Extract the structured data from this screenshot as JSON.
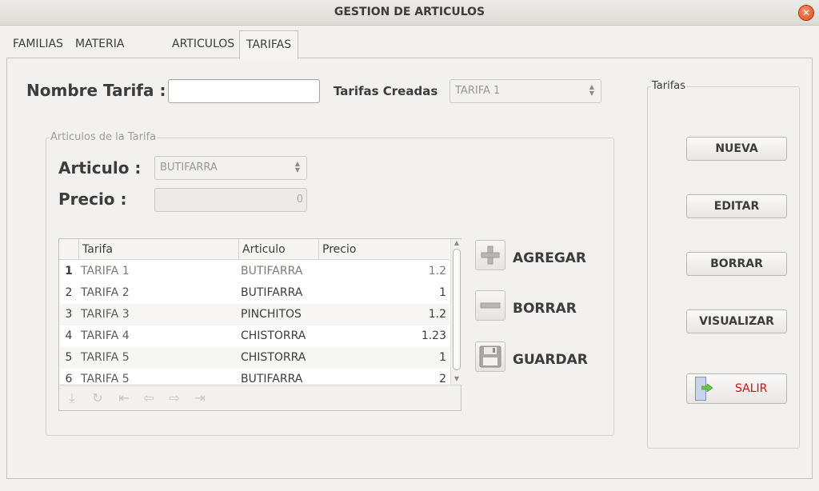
{
  "window": {
    "title": "GESTION DE ARTICULOS"
  },
  "tabs": [
    {
      "label": "FAMILIAS"
    },
    {
      "label": "MATERIA PRIMA"
    },
    {
      "label": "ARTICULOS"
    },
    {
      "label": "TARIFAS",
      "active": true
    }
  ],
  "form": {
    "nombre_label": "Nombre Tarifa :",
    "nombre_value": "",
    "creadas_label": "Tarifas Creadas",
    "creadas_value": "TARIFA 1"
  },
  "articulos_group": {
    "title": "Articulos de la Tarifa",
    "articulo_label": "Articulo :",
    "articulo_value": "BUTIFARRA",
    "precio_label": "Precio :",
    "precio_value": "0"
  },
  "table": {
    "columns": [
      "Tarifa",
      "Articulo",
      "Precio"
    ],
    "rows": [
      {
        "num": "1",
        "tarifa": "TARIFA 1",
        "articulo": "BUTIFARRA",
        "precio": "1.2"
      },
      {
        "num": "2",
        "tarifa": "TARIFA 2",
        "articulo": "BUTIFARRA",
        "precio": "1"
      },
      {
        "num": "3",
        "tarifa": "TARIFA 3",
        "articulo": "PINCHITOS",
        "precio": "1.2"
      },
      {
        "num": "4",
        "tarifa": "TARIFA 4",
        "articulo": "CHISTORRA",
        "precio": "1.23"
      },
      {
        "num": "5",
        "tarifa": "TARIFA 5",
        "articulo": "CHISTORRA",
        "precio": "1"
      },
      {
        "num": "6",
        "tarifa": "TARIFA 5",
        "articulo": "BUTIFARRA",
        "precio": "2"
      }
    ]
  },
  "row_actions": {
    "agregar": "AGREGAR",
    "borrar": "BORRAR",
    "guardar": "GUARDAR"
  },
  "tarifas_panel": {
    "title": "Tarifas",
    "nueva": "NUEVA",
    "editar": "EDITAR",
    "borrar": "BORRAR",
    "visualizar": "VISUALIZAR",
    "salir": "SALIR"
  },
  "colors": {
    "salir_text": "#d01010",
    "close_button": "#df4a1d"
  },
  "icons": {
    "close": "close-icon",
    "agregar": "plus-icon",
    "borrar": "minus-icon",
    "guardar": "floppy-disk-icon",
    "salir": "exit-door-icon"
  }
}
